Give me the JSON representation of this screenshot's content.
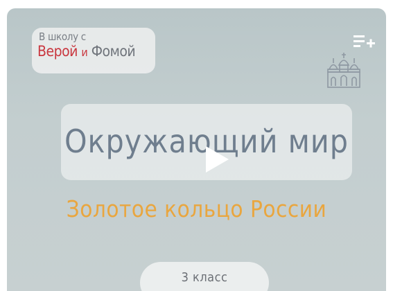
{
  "video": {
    "logo": {
      "line1": "В школу с",
      "name1": "Верой",
      "conj": "и",
      "name2": "Фомой"
    },
    "title": "Окружающий мир",
    "subtitle": "Золотое кольцо России",
    "grade": "3 класс"
  },
  "icons": {
    "queue": "add-to-queue-icon",
    "church": "church-icon",
    "play": "play-icon"
  },
  "colors": {
    "background": "#c3cecf",
    "title": "#6f7e8e",
    "subtitle": "#e9a63f",
    "logo_accent": "#c9373f"
  }
}
